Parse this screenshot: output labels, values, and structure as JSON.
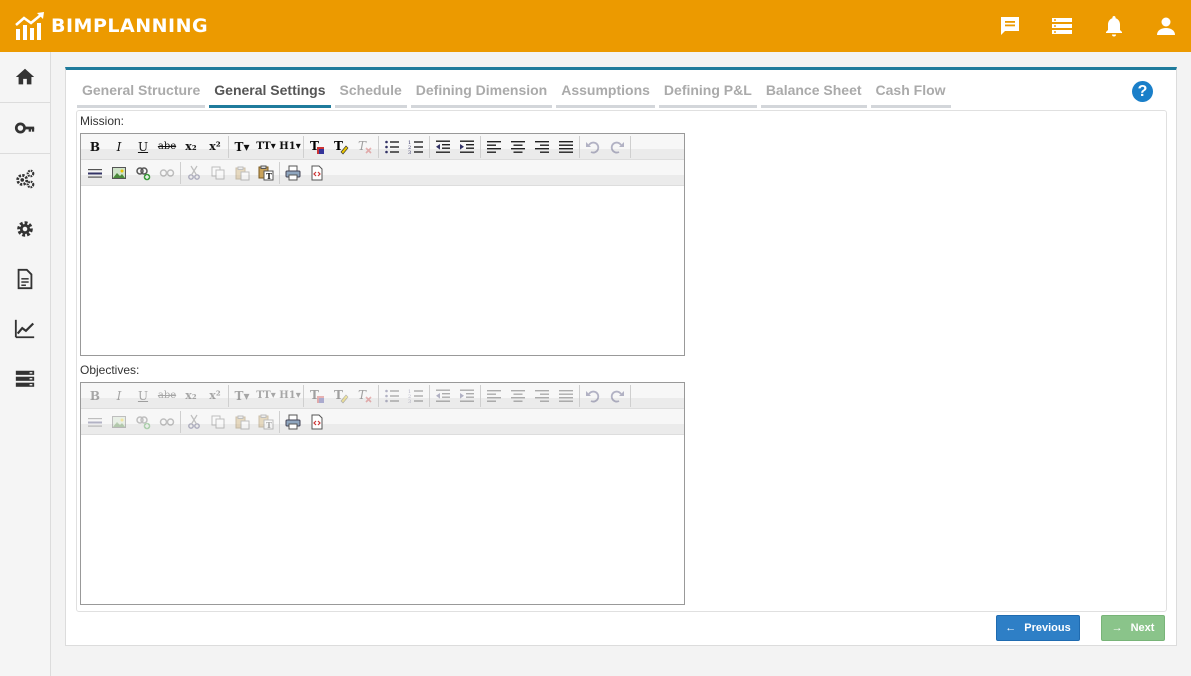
{
  "app": {
    "brand_name": "BIMPLANNING",
    "brand_color": "#ec9a00",
    "accent_color": "#1f7b9c"
  },
  "topbar": {
    "icons": [
      "messages-icon",
      "list-icon",
      "notifications-icon",
      "user-icon"
    ]
  },
  "sidebar": {
    "items": [
      "home-icon",
      "key-icon",
      "gears-icon",
      "settings-icon",
      "document-icon",
      "chart-icon",
      "database-icon"
    ]
  },
  "tabs": [
    {
      "label": "General Structure",
      "active": false
    },
    {
      "label": "General Settings",
      "active": true
    },
    {
      "label": "Schedule",
      "active": false
    },
    {
      "label": "Defining Dimension",
      "active": false
    },
    {
      "label": "Assumptions",
      "active": false
    },
    {
      "label": "Defining P&L",
      "active": false
    },
    {
      "label": "Balance Sheet",
      "active": false
    },
    {
      "label": "Cash Flow",
      "active": false
    }
  ],
  "help": {
    "label": "?"
  },
  "fields": {
    "mission": {
      "label": "Mission:",
      "value": ""
    },
    "objectives": {
      "label": "Objectives:",
      "value": ""
    }
  },
  "toolbar": {
    "bold": "B",
    "italic": "I",
    "underline": "U",
    "strike": "abe",
    "subscript": "x₂",
    "superscript": "x²",
    "font": "T",
    "font_size": "TT",
    "heading": "H1"
  },
  "nav": {
    "previous_label": "Previous",
    "next_label": "Next"
  }
}
